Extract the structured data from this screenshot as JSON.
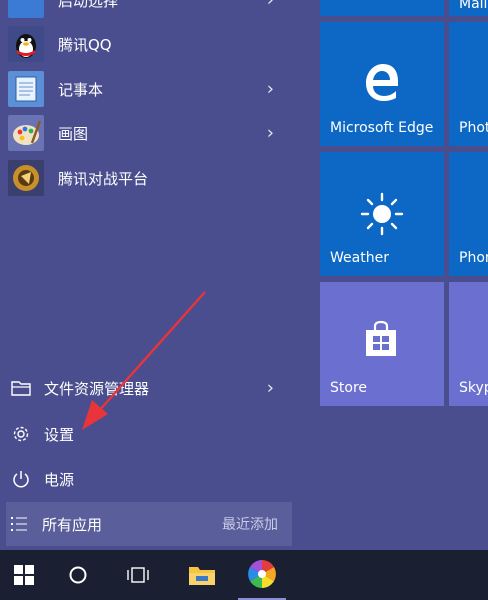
{
  "start_menu": {
    "apps": [
      {
        "label": "启动选择",
        "icon": "app-icon"
      },
      {
        "label": "腾讯QQ",
        "icon": "qq-penguin-icon"
      },
      {
        "label": "记事本",
        "icon": "notepad-icon"
      },
      {
        "label": "画图",
        "icon": "paint-palette-icon"
      },
      {
        "label": "腾讯对战平台",
        "icon": "game-platform-icon"
      }
    ],
    "system": [
      {
        "label": "文件资源管理器",
        "icon": "file-explorer-icon"
      },
      {
        "label": "设置",
        "icon": "gear-icon"
      },
      {
        "label": "电源",
        "icon": "power-icon"
      }
    ],
    "all_apps": {
      "label": "所有应用",
      "recent": "最近添加"
    }
  },
  "tiles": {
    "top_right": "Mail",
    "edge": "Microsoft Edge",
    "photos": "Photos",
    "weather": "Weather",
    "phone": "Phone",
    "store": "Store",
    "skype": "Skype"
  },
  "colors": {
    "menu_bg": "#4a4e8e",
    "tile_blue": "#0c68c4",
    "tile_lavender": "#6b6fd0",
    "taskbar": "#1a1f32",
    "annotation_arrow": "#e8343a"
  },
  "taskbar": {
    "icons": [
      "windows-start-icon",
      "cortana-circle-icon",
      "task-view-icon",
      "file-explorer-folder-icon",
      "colorful-app-icon"
    ]
  }
}
